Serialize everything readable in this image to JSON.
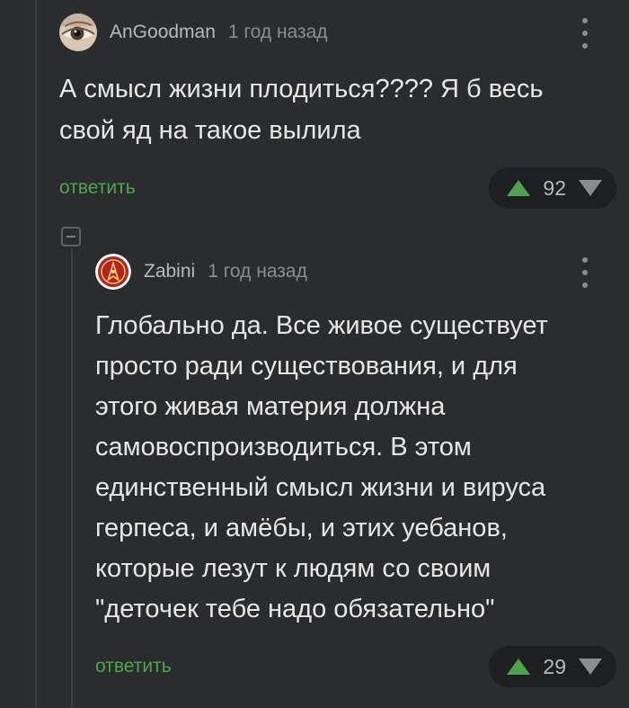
{
  "colors": {
    "background": "#2b2c2e",
    "text": "#e6e6e6",
    "reply": "#4ea34f",
    "upvote": "#4ea34f",
    "muted": "#8a8c90",
    "vote_pill": "#1e1f21"
  },
  "comments": [
    {
      "username": "AnGoodman",
      "time": "1 год назад",
      "avatar_icon": "eye-avatar",
      "lines": [
        "А смысл жизни плодиться???? Я б весь",
        "свой яд на такое вылила"
      ],
      "reply_label": "ответить",
      "votes": "92"
    },
    {
      "username": "Zabini",
      "time": "1 год назад",
      "avatar_icon": "starfleet-badge-avatar",
      "lines": [
        "Глобально да. Все живое существует",
        "просто ради существования, и для",
        "этого живая материя должна",
        "самовоспроизводиться. В этом",
        "единственный смысл жизни и вируса",
        "герпеса, и амёбы, и этих уебанов,",
        "которые лезут к людям со своим",
        "\"деточек тебе надо обязательно\""
      ],
      "reply_label": "ответить",
      "votes": "29"
    }
  ]
}
